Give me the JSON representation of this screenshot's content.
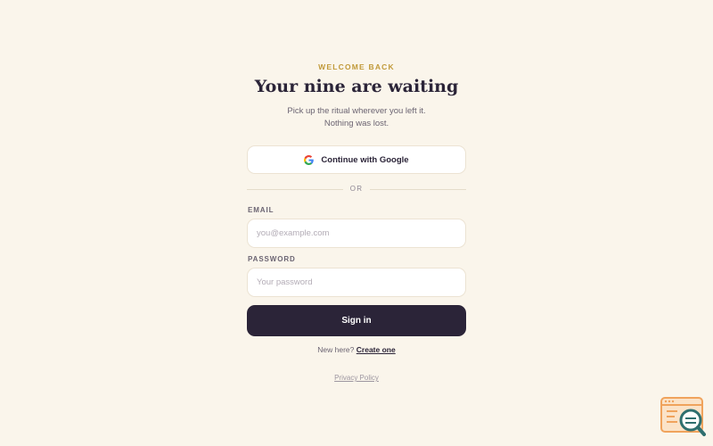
{
  "header": {
    "eyebrow": "WELCOME BACK",
    "title": "Your nine are waiting",
    "subtitle_line1": "Pick up the ritual wherever you left it.",
    "subtitle_line2": "Nothing was lost."
  },
  "google": {
    "label": "Continue with Google",
    "icon": "google-g-icon"
  },
  "divider": {
    "label": "OR"
  },
  "form": {
    "email_label": "EMAIL",
    "email_value": "",
    "email_placeholder": "you@example.com",
    "password_label": "PASSWORD",
    "password_value": "",
    "password_placeholder": "Your password",
    "submit_label": "Sign in"
  },
  "footer": {
    "new_here": "New here?",
    "create_link": "Create one",
    "privacy_link": "Privacy Policy"
  },
  "corner_logo": {
    "icon": "browser-search-icon"
  },
  "colors": {
    "background": "#faf5eb",
    "accent_gold": "#c19a3a",
    "primary_dark": "#2b2438",
    "logo_orange": "#f0a35c",
    "logo_teal": "#2f6f6f"
  }
}
